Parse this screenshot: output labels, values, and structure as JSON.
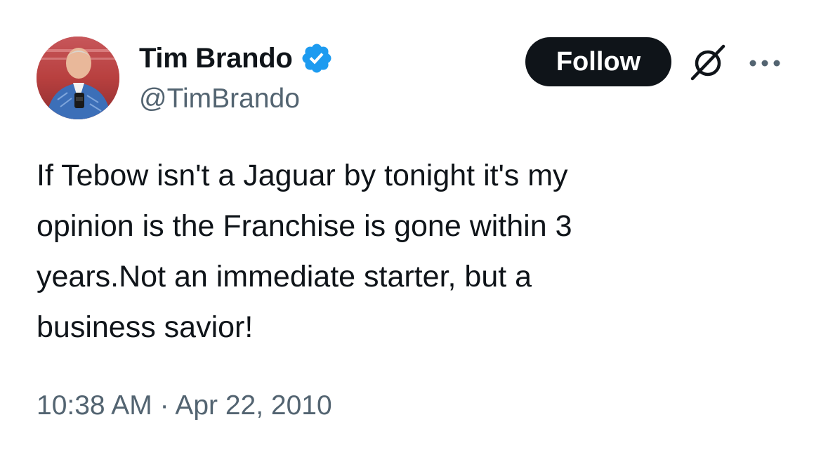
{
  "author": {
    "display_name": "Tim Brando",
    "handle": "@TimBrando",
    "verified": true,
    "verified_color": "#1d9bf0"
  },
  "actions": {
    "follow_label": "Follow",
    "icons": [
      "grok-icon",
      "more-options-icon"
    ]
  },
  "tweet": {
    "text": "If Tebow isn't a Jaguar by tonight it's my\nopinion is the Franchise is gone within 3\nyears.Not an immediate starter, but a\nbusiness savior!",
    "time": "10:38 AM",
    "separator": "·",
    "date": "Apr 22, 2010"
  },
  "colors": {
    "text": "#0f1419",
    "secondary_text": "#536471",
    "follow_button_bg": "#0f1419",
    "follow_button_text": "#ffffff"
  }
}
